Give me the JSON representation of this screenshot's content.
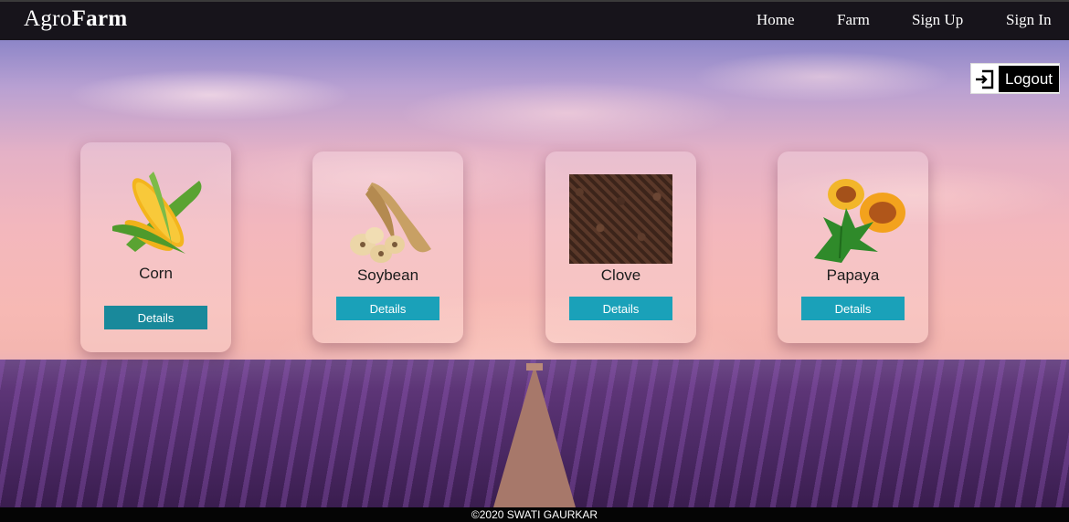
{
  "brand": {
    "prefix": "Agro",
    "bold": "Farm"
  },
  "nav": {
    "items": [
      "Home",
      "Farm",
      "Sign Up",
      "Sign In"
    ]
  },
  "logout": {
    "label": "Logout"
  },
  "cards": [
    {
      "name": "Corn",
      "button": "Details"
    },
    {
      "name": "Soybean",
      "button": "Details"
    },
    {
      "name": "Clove",
      "button": "Details"
    },
    {
      "name": "Papaya",
      "button": "Details"
    }
  ],
  "footer": {
    "text": "©2020 SWATI GAURKAR"
  },
  "colors": {
    "accent": "#1aa1b9",
    "navbar": "#17141b",
    "footer": "#050505"
  }
}
